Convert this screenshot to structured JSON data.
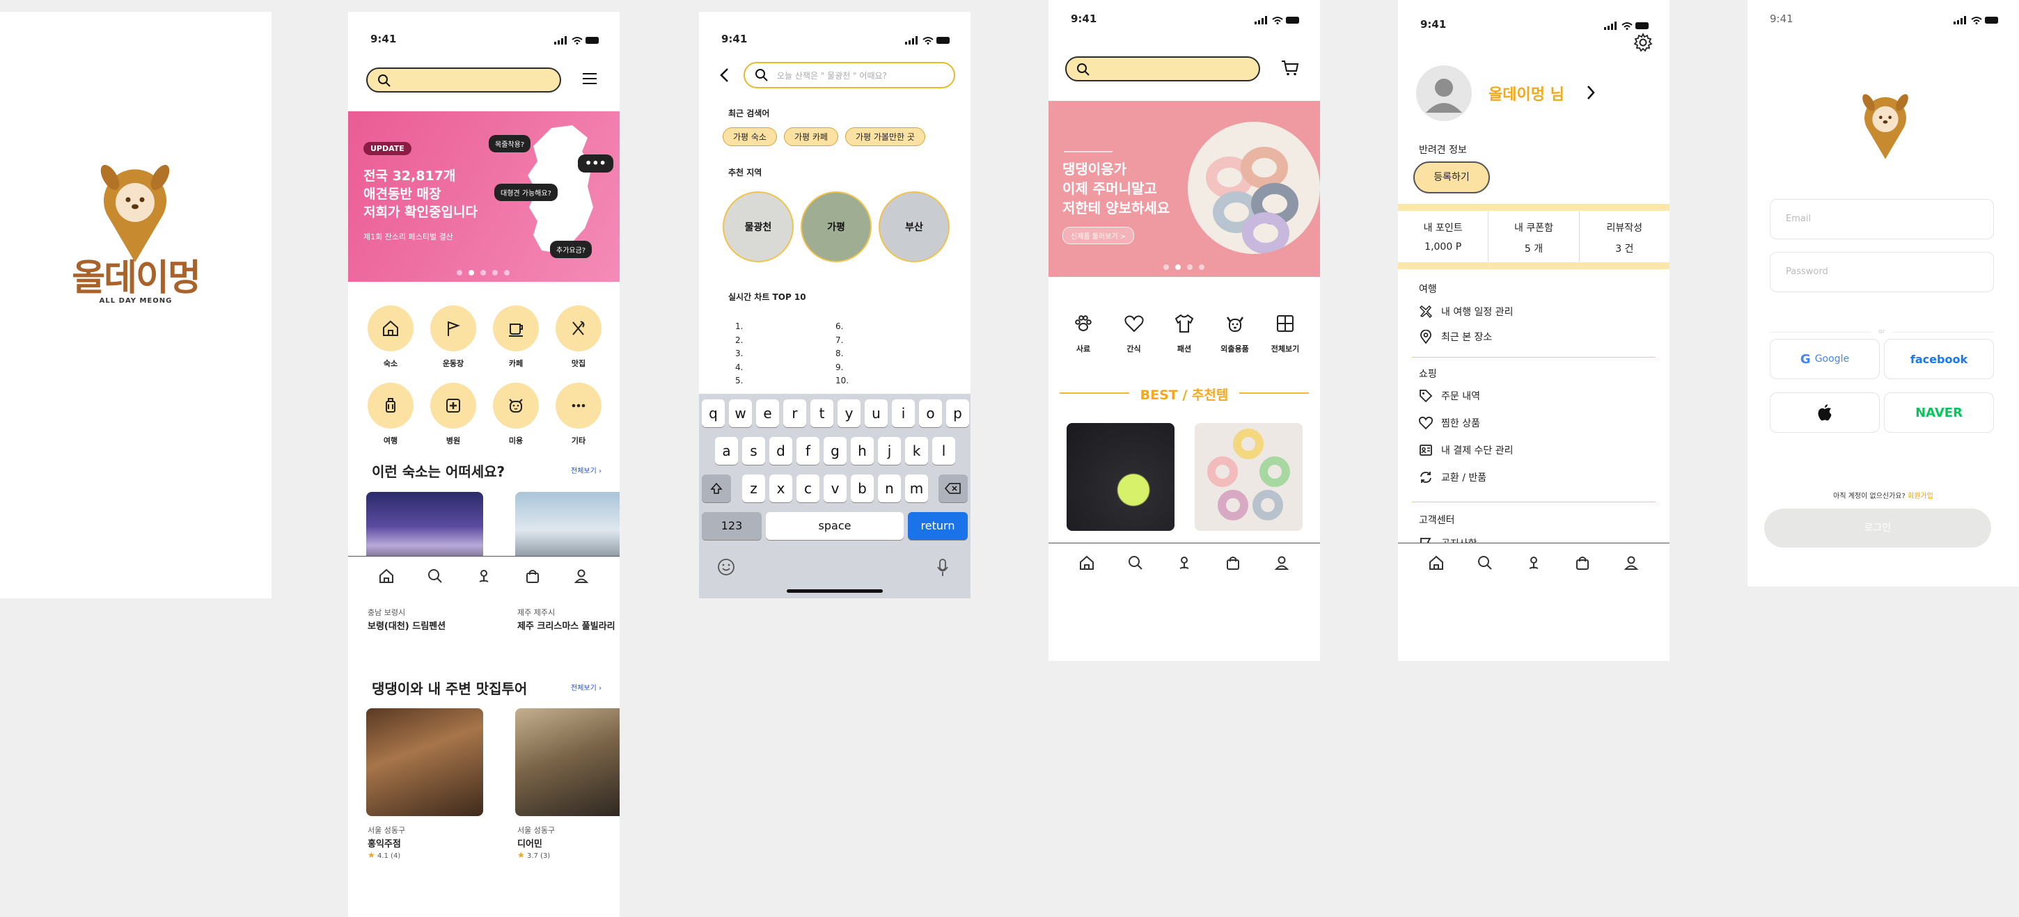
{
  "colors": {
    "accent": "#f4b928",
    "brand_brown": "#b27627",
    "pink": "#f06aa0",
    "search_fill": "#fbe7a9"
  },
  "splash": {
    "logo_korean": "올데이멍",
    "logo_english": "ALL DAY MEONG"
  },
  "home": {
    "time": "9:41",
    "banner": {
      "badge": "UPDATE",
      "line1": "전국 32,817개",
      "line2": "애견동반 매장",
      "line3": "저희가 확인중입니다",
      "sub": "제1회 잔소리 페스티벌 결산",
      "bubble1": "목줄착용?",
      "bubble2": "대형견 가능해요?",
      "bubble3": "추가요금?",
      "dots_icon": "more-icon"
    },
    "categories": [
      {
        "label": "숙소",
        "icon": "house-icon"
      },
      {
        "label": "운동장",
        "icon": "flag-icon"
      },
      {
        "label": "카페",
        "icon": "cup-icon"
      },
      {
        "label": "맛집",
        "icon": "utensils-icon"
      },
      {
        "label": "여행",
        "icon": "luggage-icon"
      },
      {
        "label": "병원",
        "icon": "hospital-icon"
      },
      {
        "label": "미용",
        "icon": "dog-face-icon"
      },
      {
        "label": "기타",
        "icon": "more-icon"
      }
    ],
    "section1": {
      "title": "이런 숙소는 어떠세요?",
      "more": "전체보기"
    },
    "stays": [
      {
        "region": "충남 보령시",
        "name": "보령(대천) 드림펜션"
      },
      {
        "region": "제주 제주시",
        "name": "제주 크리스마스 풀빌라리"
      }
    ],
    "section2": {
      "title": "댕댕이와 내 주변 맛집투어",
      "more": "전체보기"
    },
    "restaurants": [
      {
        "region": "서울 성동구",
        "name": "홍익주점",
        "rating": "4.1",
        "count": "(4)"
      },
      {
        "region": "서울 성동구",
        "name": "디어민",
        "rating": "3.7",
        "count": "(3)"
      }
    ]
  },
  "search": {
    "time": "9:41",
    "placeholder": "오늘 산책은 \" 물광천 \" 어때요?",
    "recent_title": "최근 검색어",
    "recent": [
      "가평 숙소",
      "가평 카페",
      "가평 가볼만한 곳"
    ],
    "region_title": "추천 지역",
    "regions": [
      "물광천",
      "가평",
      "부산"
    ],
    "chart_title": "실시간 차트 TOP 10",
    "ranks_left": [
      "1.",
      "2.",
      "3.",
      "4.",
      "5."
    ],
    "ranks_right": [
      "6.",
      "7.",
      "8.",
      "9.",
      "10."
    ],
    "keyboard": {
      "row1": [
        "q",
        "w",
        "e",
        "r",
        "t",
        "y",
        "u",
        "i",
        "o",
        "p"
      ],
      "row2": [
        "a",
        "s",
        "d",
        "f",
        "g",
        "h",
        "j",
        "k",
        "l"
      ],
      "row3": [
        "z",
        "x",
        "c",
        "v",
        "b",
        "n",
        "m"
      ],
      "num": "123",
      "space": "space",
      "return": "return"
    }
  },
  "shop": {
    "time": "9:41",
    "banner": {
      "line1": "댕댕이응가",
      "line2": "이제 주머니말고",
      "line3": "저한테 양보하세요",
      "button": "신제품 둘러보기 >"
    },
    "categories": [
      {
        "label": "사료",
        "icon": "paw-icon"
      },
      {
        "label": "간식",
        "icon": "heart-icon"
      },
      {
        "label": "패션",
        "icon": "shirt-icon"
      },
      {
        "label": "외출용품",
        "icon": "dog-icon"
      },
      {
        "label": "전체보기",
        "icon": "grid-icon"
      }
    ],
    "best_title": "BEST / 추천템"
  },
  "mypage": {
    "time": "9:41",
    "username": "올데이멍 님",
    "pet_title": "반려견 정보",
    "register": "등록하기",
    "stats": [
      {
        "label": "내 포인트",
        "value": "1,000 P"
      },
      {
        "label": "내 쿠폰함",
        "value": "5 개"
      },
      {
        "label": "리뷰작성",
        "value": "3 건"
      }
    ],
    "travel_title": "여행",
    "travel_items": [
      "내 여행 일정 관리",
      "최근 본 장소"
    ],
    "shopping_title": "쇼핑",
    "shopping_items": [
      "주문 내역",
      "찜한 상품",
      "내 결제 수단 관리",
      "교환 / 반품"
    ],
    "support_title": "고객센터",
    "support_items": [
      "공지사항"
    ]
  },
  "login": {
    "time": "9:41",
    "email_placeholder": "Email",
    "password_placeholder": "Password",
    "or": "or",
    "google": "Google",
    "facebook": "facebook",
    "naver": "NAVER",
    "no_account": "아직 계정이 없으신가요?",
    "signup": "회원가입",
    "login_button": "로그인"
  }
}
